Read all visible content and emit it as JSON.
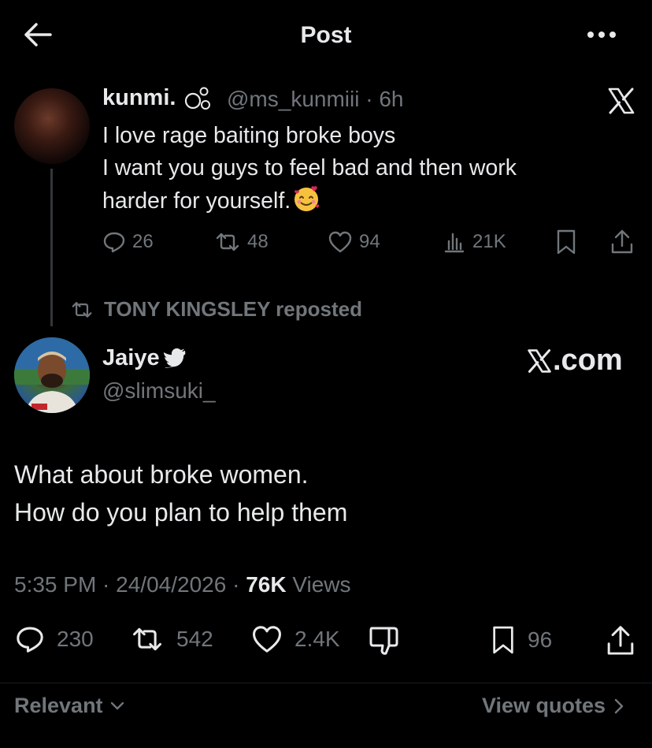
{
  "header": {
    "title": "Post"
  },
  "quoted_post": {
    "author_name": "kunmi.",
    "handle_time": "@ms_kunmiii · 6h",
    "lines": [
      "I love rage baiting broke boys",
      "I want you guys to feel bad and then work",
      "harder for yourself."
    ],
    "emoji_icon": "smiling-face-with-hearts-icon",
    "stats": {
      "replies": "26",
      "reposts": "48",
      "likes": "94",
      "views": "21K"
    }
  },
  "repost_label": "TONY KINGSLEY reposted",
  "main_post": {
    "author_name": "Jaiye",
    "handle": "@slimsuki_",
    "watermark": ".com",
    "lines": [
      "What about broke women.",
      "How do you plan to help them"
    ],
    "meta": {
      "time_date": "5:35 PM · 24/04/2026 · ",
      "views_count": "76K",
      "views_label": " Views"
    },
    "stats": {
      "replies": "230",
      "reposts": "542",
      "likes": "2.4K",
      "bookmarks": "96"
    }
  },
  "footer": {
    "sort_label": "Relevant",
    "quotes_label": "View quotes"
  },
  "colors": {
    "background": "#000000",
    "text_primary": "#e7e9ea",
    "text_muted": "#71767b"
  }
}
